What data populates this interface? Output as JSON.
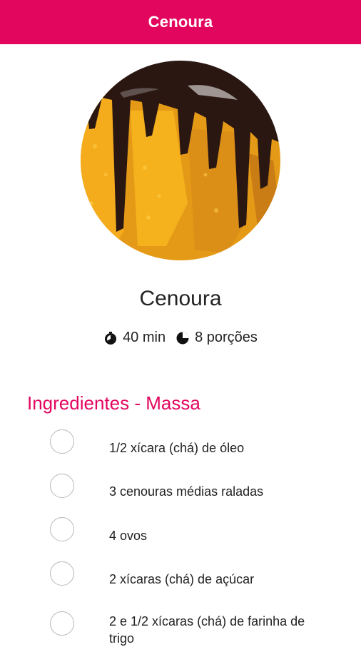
{
  "header": {
    "title": "Cenoura"
  },
  "recipe": {
    "image": {
      "icon": "carrot-cake-photo"
    },
    "title": "Cenoura",
    "time": {
      "icon": "timer-icon",
      "text": "40 min"
    },
    "servings": {
      "icon": "pie-icon",
      "text": "8 porções"
    }
  },
  "ingredients": {
    "section_title": "Ingredientes - Massa",
    "items": [
      {
        "label": "1/2 xícara (chá) de óleo",
        "checked": false
      },
      {
        "label": "3 cenouras médias raladas",
        "checked": false
      },
      {
        "label": "4 ovos",
        "checked": false
      },
      {
        "label": "2 xícaras (chá) de açúcar",
        "checked": false
      },
      {
        "label": "2 e 1/2 xícaras (chá) de farinha de trigo",
        "checked": false
      }
    ]
  },
  "colors": {
    "accent": "#e3065f",
    "chocolate": "#2a1712",
    "cake_crumb": "#f2a20e"
  }
}
